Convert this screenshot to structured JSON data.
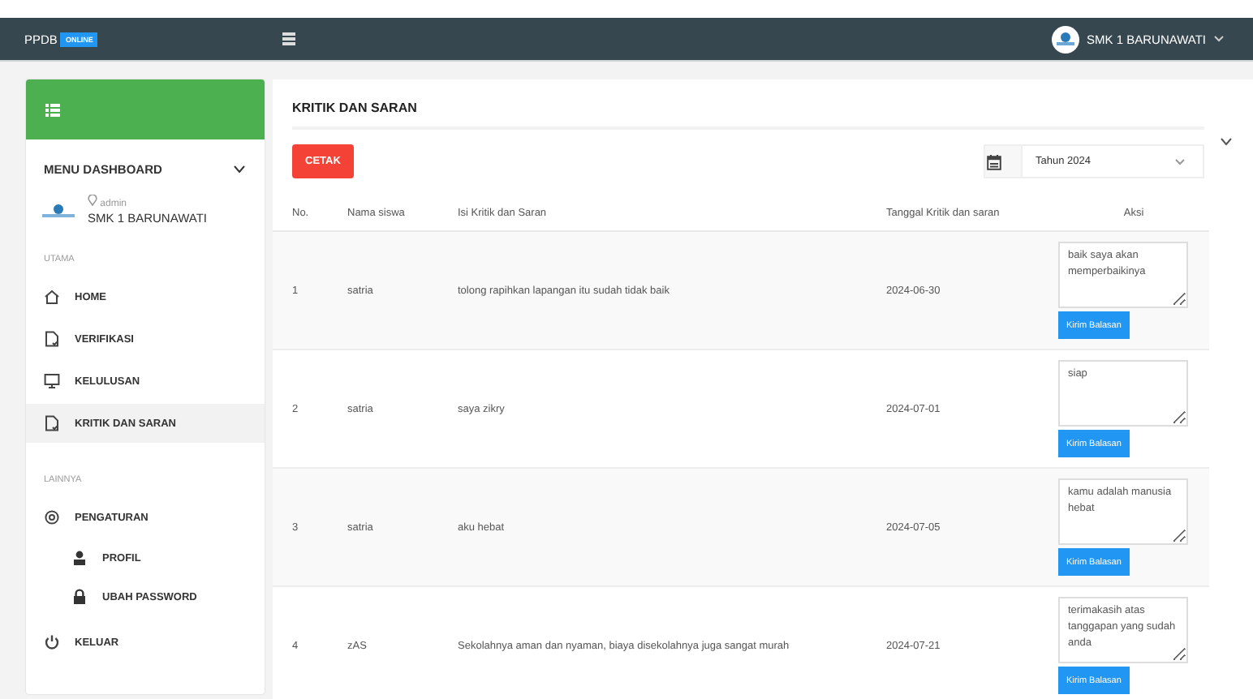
{
  "navbar": {
    "brand": "PPDB",
    "badge": "ONLINE",
    "user": "SMK 1 BARUNAWATI"
  },
  "sidebar": {
    "title": "MENU DASHBOARD",
    "profile": {
      "role": "admin",
      "name": "SMK 1 BARUNAWATI"
    },
    "sections": [
      {
        "heading": "UTAMA",
        "items": [
          {
            "label": "HOME",
            "kind": "home",
            "selected": false
          },
          {
            "label": "VERIFIKASI",
            "kind": "file",
            "selected": false
          },
          {
            "label": "KELULUSAN",
            "kind": "monitor",
            "selected": false
          },
          {
            "label": "KRITIK DAN SARAN",
            "kind": "file",
            "selected": true
          }
        ]
      },
      {
        "heading": "LAINNYA",
        "items": [
          {
            "label": "PENGATURAN",
            "kind": "gear",
            "selected": false,
            "children": [
              {
                "label": "PROFIL",
                "kind": "person",
                "selected": false
              },
              {
                "label": "UBAH PASSWORD",
                "kind": "lock",
                "selected": false
              }
            ]
          },
          {
            "label": "KELUAR",
            "kind": "power",
            "selected": false
          }
        ]
      }
    ]
  },
  "main": {
    "title": "KRITIK DAN SARAN",
    "print_button": "CETAK",
    "year_filter": {
      "value": "Tahun 2024"
    },
    "table": {
      "columns": [
        "No.",
        "Nama siswa",
        "Isi Kritik dan Saran",
        "Tanggal Kritik dan saran",
        "Aksi"
      ],
      "rows": [
        {
          "no": "1",
          "name": "satria",
          "message": "tolong rapihkan lapangan itu sudah tidak baik",
          "date": "2024-06-30",
          "reply": "baik saya akan memperbaikinya",
          "button": "Kirim Balasan"
        },
        {
          "no": "2",
          "name": "satria",
          "message": "saya zikry",
          "date": "2024-07-01",
          "reply": "siap",
          "button": "Kirim Balasan"
        },
        {
          "no": "3",
          "name": "satria",
          "message": "aku hebat",
          "date": "2024-07-05",
          "reply": "kamu adalah manusia hebat",
          "button": "Kirim Balasan"
        },
        {
          "no": "4",
          "name": "zAS",
          "message": "Sekolahnya aman dan nyaman, biaya disekolahnya juga sangat murah",
          "date": "2024-07-21",
          "reply": "terimakasih atas tanggapan yang sudah anda",
          "button": "Kirim Balasan"
        }
      ]
    }
  }
}
